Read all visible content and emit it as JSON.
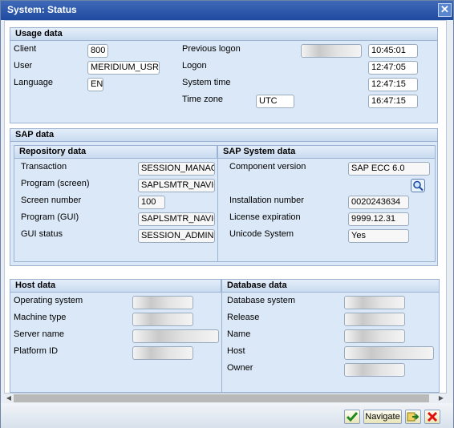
{
  "window": {
    "title": "System: Status",
    "close_glyph": "✕"
  },
  "usage": {
    "title": "Usage data",
    "client_label": "Client",
    "client_value": "800",
    "user_label": "User",
    "user_value": "MERIDIUM_USR",
    "language_label": "Language",
    "language_value": "EN",
    "prev_logon_label": "Previous logon",
    "prev_logon_time": "10:45:01",
    "logon_label": "Logon",
    "logon_time": "12:47:05",
    "system_time_label": "System time",
    "system_time": "12:47:15",
    "timezone_label": "Time zone",
    "timezone_value": "UTC",
    "timezone_time": "16:47:15"
  },
  "sap": {
    "title": "SAP data",
    "repo": {
      "title": "Repository data",
      "transaction_label": "Transaction",
      "transaction_value": "SESSION_MANAGER",
      "program_screen_label": "Program (screen)",
      "program_screen_value": "SAPLSMTR_NAVIGATION",
      "screen_number_label": "Screen number",
      "screen_number_value": "100",
      "program_gui_label": "Program (GUI)",
      "program_gui_value": "SAPLSMTR_NAVIGATION",
      "gui_status_label": "GUI status",
      "gui_status_value": "SESSION_ADMIN"
    },
    "system": {
      "title": "SAP System data",
      "component_label": "Component version",
      "component_value": "SAP ECC 6.0",
      "installation_label": "Installation number",
      "installation_value": "0020243634",
      "license_label": "License expiration",
      "license_value": "9999.12.31",
      "unicode_label": "Unicode System",
      "unicode_value": "Yes"
    }
  },
  "host": {
    "title": "Host data",
    "os_label": "Operating system",
    "machine_label": "Machine type",
    "server_label": "Server name",
    "platform_label": "Platform ID"
  },
  "database": {
    "title": "Database data",
    "system_label": "Database system",
    "release_label": "Release",
    "name_label": "Name",
    "host_label": "Host",
    "owner_label": "Owner"
  },
  "footer": {
    "navigate_label": "Navigate"
  },
  "icons": {
    "confirm": "check-icon",
    "navigate_next": "arrow-right-icon",
    "cancel": "cancel-icon",
    "details": "magnifier-icon"
  }
}
